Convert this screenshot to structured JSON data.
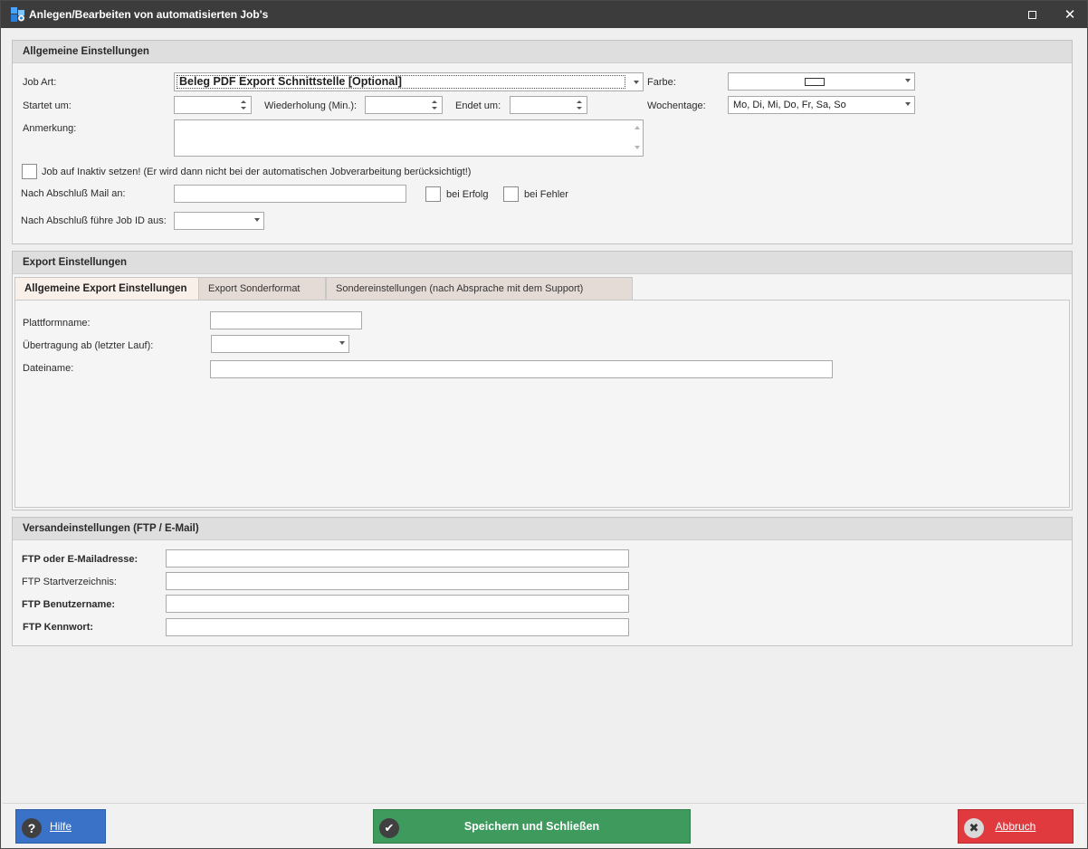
{
  "window": {
    "title": "Anlegen/Bearbeiten von automatisierten Job's"
  },
  "general": {
    "header": "Allgemeine Einstellungen",
    "job_art_label": "Job Art:",
    "job_art_value": "Beleg PDF Export Schnittstelle [Optional]",
    "farbe_label": "Farbe:",
    "startet_label": "Startet um:",
    "startet_value": "",
    "wiederholung_label": "Wiederholung (Min.):",
    "wiederholung_value": "",
    "endet_label": "Endet um:",
    "endet_value": "",
    "wochentage_label": "Wochentage:",
    "wochentage_value": "Mo, Di, Mi, Do, Fr, Sa, So",
    "anmerkung_label": "Anmerkung:",
    "anmerkung_value": "",
    "inaktiv_label": "Job auf Inaktiv setzen! (Er wird dann nicht bei der automatischen Jobverarbeitung berücksichtigt!)",
    "mail_label": "Nach Abschluß Mail an:",
    "mail_value": "",
    "bei_erfolg_label": "bei Erfolg",
    "bei_fehler_label": "bei Fehler",
    "job_id_label": "Nach Abschluß führe Job ID aus:",
    "job_id_value": ""
  },
  "export": {
    "header": "Export Einstellungen",
    "tabs": [
      {
        "label": "Allgemeine Export Einstellungen",
        "active": true
      },
      {
        "label": "Export Sonderformat",
        "active": false
      },
      {
        "label": "Sondereinstellungen (nach Absprache mit dem Support)",
        "active": false
      }
    ],
    "plattform_label": "Plattformname:",
    "plattform_value": "",
    "uebertragung_label": "Übertragung ab (letzter Lauf):",
    "uebertragung_value": "",
    "dateiname_label": "Dateiname:",
    "dateiname_value": ""
  },
  "versand": {
    "header": "Versandeinstellungen (FTP / E-Mail)",
    "ftp_address_label": "FTP oder E-Mailadresse:",
    "ftp_address_value": "",
    "ftp_dir_label": "FTP Startverzeichnis:",
    "ftp_dir_value": "",
    "ftp_user_label": "FTP Benutzername:",
    "ftp_user_value": "",
    "ftp_pass_label": "FTP Kennwort:",
    "ftp_pass_value": ""
  },
  "footer": {
    "help_label": "Hilfe",
    "save_label": "Speichern und Schließen",
    "cancel_label": "Abbruch"
  },
  "colors": {
    "help": "#3a72c8",
    "save": "#3f9a5e",
    "cancel": "#e0393e",
    "titlebar": "#3c3c3c"
  },
  "icons": {
    "help": "question-icon",
    "save": "check-icon",
    "cancel": "x-icon"
  }
}
